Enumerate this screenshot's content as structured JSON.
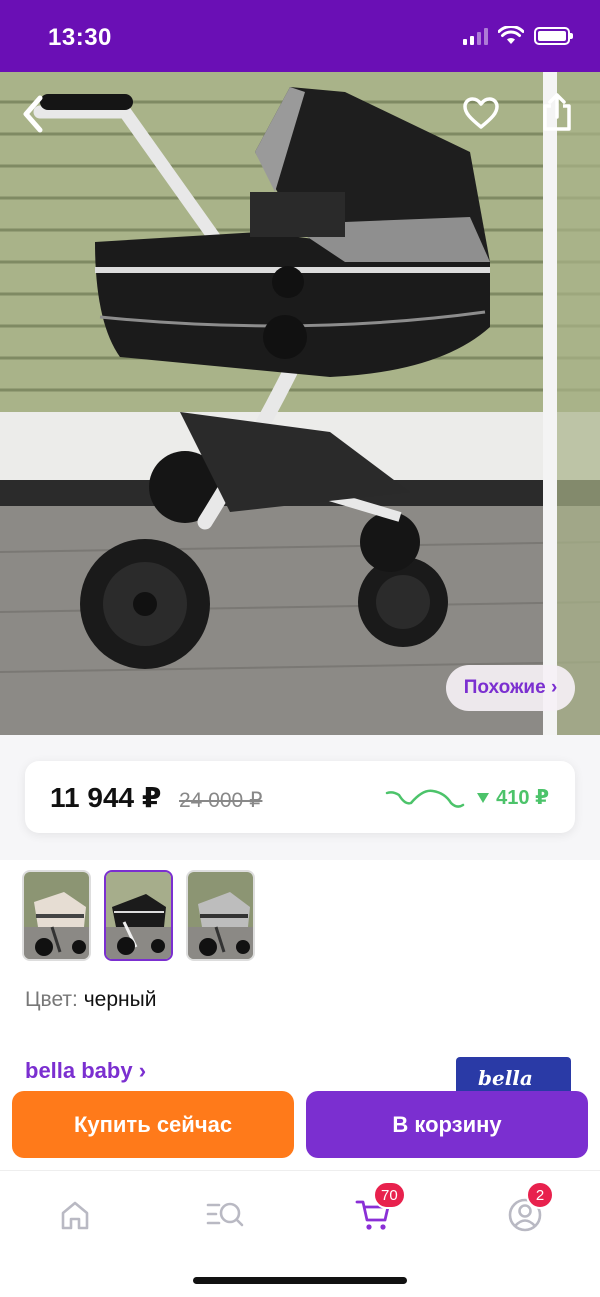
{
  "status_bar": {
    "time": "13:30",
    "background": "#6a0fb5"
  },
  "hero": {
    "back_icon": "chevron-left-icon",
    "favorite_icon": "heart-icon",
    "share_icon": "share-icon",
    "similar_label": "Похожие ›"
  },
  "price": {
    "current": "11 944 ₽",
    "old": "24 000 ₽",
    "drop": "410 ₽",
    "drop_icon": "triangle-down-icon",
    "accent_green": "#4cc36a"
  },
  "thumbnails": [
    {
      "color": "beige",
      "selected": false
    },
    {
      "color": "black",
      "selected": true
    },
    {
      "color": "grey",
      "selected": false
    }
  ],
  "color_option": {
    "label": "Цвет:",
    "value": "черный"
  },
  "brand": {
    "link": "bella baby ›",
    "logo_text": "bella"
  },
  "actions": {
    "buy_now": "Купить сейчас",
    "add_to_cart": "В корзину"
  },
  "tab_bar": {
    "items": [
      {
        "icon": "home-icon"
      },
      {
        "icon": "catalog-search-icon"
      },
      {
        "icon": "cart-icon",
        "badge": "70"
      },
      {
        "icon": "profile-icon",
        "badge": "2"
      }
    ]
  },
  "colors": {
    "brand_purple": "#7b2fd0",
    "buy_orange": "#ff7a1a",
    "badge_red": "#e8214d"
  }
}
